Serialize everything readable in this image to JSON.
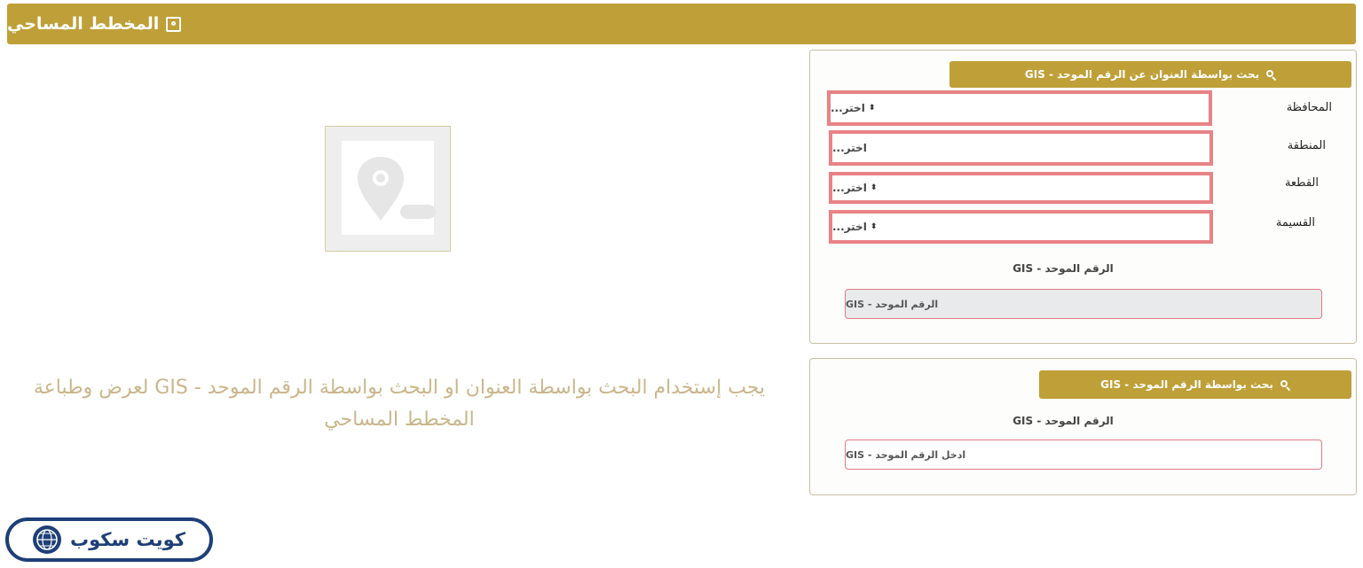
{
  "header": {
    "title": "المخطط المساحي",
    "icon": "map-pin-square-icon"
  },
  "address_search": {
    "title": "بحث بواسطة العنوان عن الرقم الموحد - GIS",
    "fields": [
      {
        "label": "المحافظة",
        "value": "اختر..."
      },
      {
        "label": "المنطقة",
        "value": "اختر..."
      },
      {
        "label": "القطعة",
        "value": "اختر..."
      },
      {
        "label": "القسيمة",
        "value": "اختر..."
      }
    ],
    "gis_label": "الرقم الموحد - GIS",
    "gis_value": "الرقم الموحد - GIS"
  },
  "gis_search": {
    "title": "بحث بواسطة الرقم الموحد - GIS",
    "gis_label": "الرقم الموحد - GIS",
    "gis_placeholder": "ادخل الرقم الموحد - GIS"
  },
  "message": "يجب إستخدام البحث بواسطة العنوان او البحث بواسطة الرقم الموحد - GIS لعرض وطباعة المخطط المساحي",
  "logo": {
    "text": "كويت سكوب",
    "icon": "globe-icon"
  },
  "colors": {
    "accent": "#bf9f37",
    "field_border": "#e88285",
    "logo": "#1e3f78"
  }
}
